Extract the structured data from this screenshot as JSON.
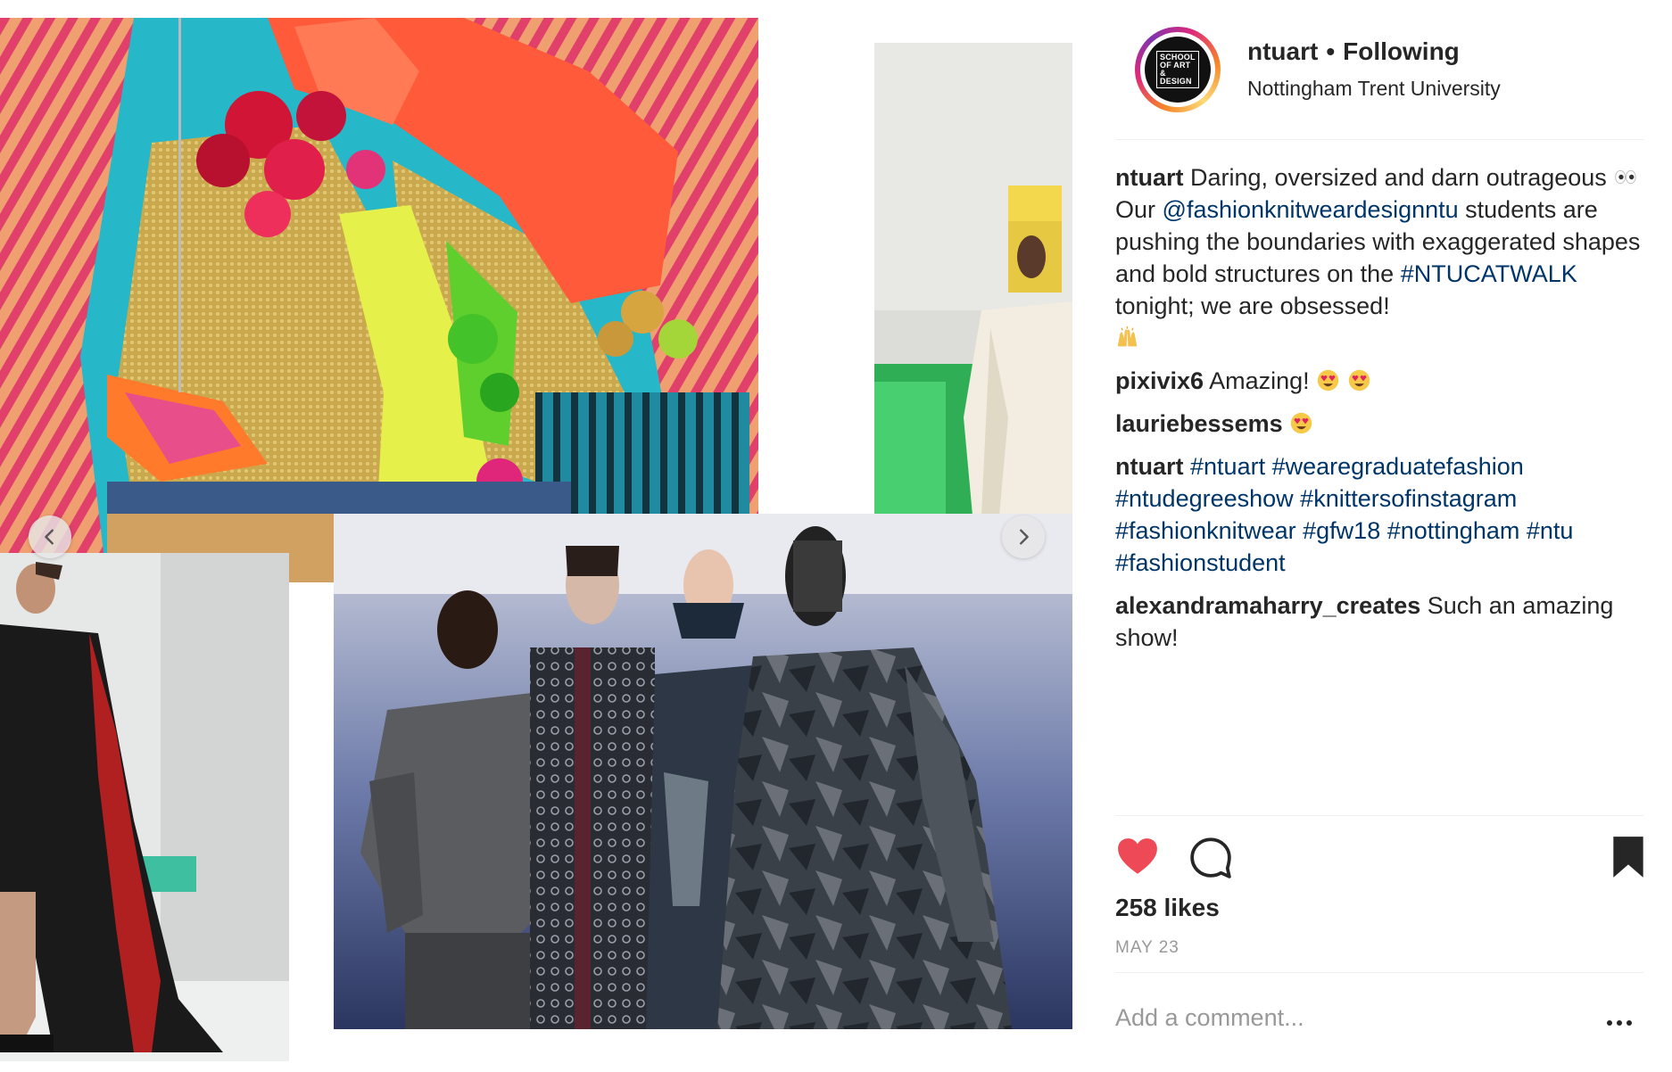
{
  "post": {
    "username": "ntuart",
    "separator": "•",
    "follow_label": "Following",
    "location": "Nottingham Trent University",
    "avatar_text": [
      "SCHOOL",
      "OF ART",
      "& DESIGN"
    ]
  },
  "caption": {
    "username": "ntuart",
    "text_1": "Daring, oversized and darn outrageous",
    "text_2": "Our",
    "mention": "@fashionknitweardesignntu",
    "text_3": "students are pushing the boundaries with exaggerated shapes and bold structures on the",
    "hashtag": "#NTUCATWALK",
    "text_4": "tonight; we are obsessed!"
  },
  "comments": [
    {
      "username": "pixivix6",
      "text": "Amazing!"
    },
    {
      "username": "lauriebessems",
      "text": ""
    },
    {
      "username": "ntuart",
      "tags": [
        "#ntuart",
        "#wearegraduatefashion",
        "#ntudegreeshow",
        "#knittersofinstagram",
        "#fashionknitwear",
        "#gfw18",
        "#nottingham",
        "#ntu",
        "#fashionstudent"
      ]
    },
    {
      "username": "alexandramaharry_creates",
      "text": "Such an amazing show!"
    }
  ],
  "actions": {
    "like_icon": "heart-filled-icon",
    "comment_icon": "speech-bubble-icon",
    "save_icon": "bookmark-filled-icon",
    "liked": true,
    "like_color": "#ed4956"
  },
  "likes_label": "258 likes",
  "date_label": "MAY 23",
  "add_comment_placeholder": "Add a comment...",
  "more_icon": "ellipsis-icon",
  "carousel": {
    "prev_icon": "chevron-left-icon",
    "next_icon": "chevron-right-icon"
  },
  "colors": {
    "text": "#262626",
    "link": "#003569",
    "muted": "#999999"
  }
}
